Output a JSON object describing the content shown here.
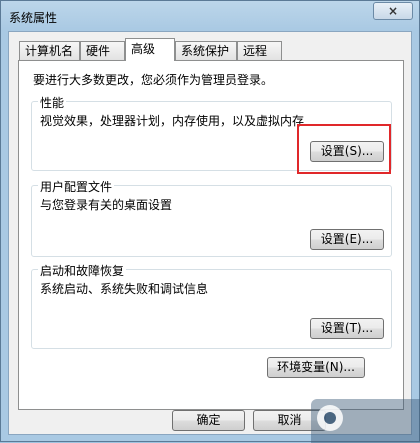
{
  "window": {
    "title": "系统属性",
    "close_label": "×"
  },
  "tabs": [
    {
      "label": "计算机名",
      "active": false
    },
    {
      "label": "硬件",
      "active": false
    },
    {
      "label": "高级",
      "active": true
    },
    {
      "label": "系统保护",
      "active": false
    },
    {
      "label": "远程",
      "active": false
    }
  ],
  "panel": {
    "admin_note": "要进行大多数更改，您必须作为管理员登录。",
    "performance": {
      "title": "性能",
      "description": "视觉效果，处理器计划，内存使用，以及虚拟内存",
      "button": "设置(S)..."
    },
    "user_profiles": {
      "title": "用户配置文件",
      "description": "与您登录有关的桌面设置",
      "button": "设置(E)..."
    },
    "startup_recovery": {
      "title": "启动和故障恢复",
      "description": "系统启动、系统失败和调试信息",
      "button": "设置(T)..."
    },
    "env_button": "环境变量(N)..."
  },
  "footer": {
    "ok": "确定",
    "cancel": "取消"
  },
  "colors": {
    "highlight": "#e0282a",
    "title_bg": "#a9c9e3"
  }
}
